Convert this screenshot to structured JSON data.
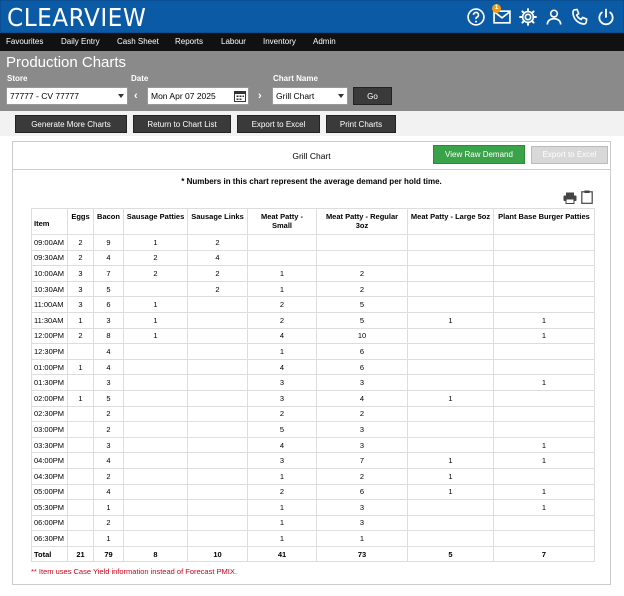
{
  "header": {
    "logo": "CLEARVIEW",
    "mail_badge": "1",
    "icons": [
      "help-icon",
      "mail-icon",
      "gear-icon",
      "user-icon",
      "phone-icon",
      "power-icon"
    ]
  },
  "nav": [
    "Favourites",
    "Daily Entry",
    "Cash Sheet",
    "Reports",
    "Labour",
    "Inventory",
    "Admin"
  ],
  "page": {
    "title": "Production Charts",
    "store_label": "Store",
    "store_value": "77777 - CV 77777",
    "date_label": "Date",
    "date_value": "Mon Apr 07 2025",
    "chart_label": "Chart Name",
    "chart_value": "Grill Chart",
    "go": "Go"
  },
  "actions": [
    "Generate More Charts",
    "Return to Chart List",
    "Export to Excel",
    "Print Charts"
  ],
  "panel": {
    "title": "Grill Chart",
    "view_raw": "View Raw Demand",
    "export": "Export to Excel",
    "note": "* Numbers in this chart represent the average demand per hold time.",
    "footnote": "** Item uses Case Yield information instead of Forecast PMIX."
  },
  "table": {
    "headers": [
      "Item",
      "Eggs",
      "Bacon",
      "Sausage Patties",
      "Sausage Links",
      "Meat Patty - Small",
      "Meat Patty - Regular 3oz",
      "Meat Patty - Large 5oz",
      "Plant Base Burger Patties"
    ],
    "rows": [
      [
        "09:00AM",
        "2",
        "9",
        "1",
        "2",
        "",
        "",
        "",
        ""
      ],
      [
        "09:30AM",
        "2",
        "4",
        "2",
        "4",
        "",
        "",
        "",
        ""
      ],
      [
        "10:00AM",
        "3",
        "7",
        "2",
        "2",
        "1",
        "2",
        "",
        ""
      ],
      [
        "10:30AM",
        "3",
        "5",
        "",
        "2",
        "1",
        "2",
        "",
        ""
      ],
      [
        "11:00AM",
        "3",
        "6",
        "1",
        "",
        "2",
        "5",
        "",
        ""
      ],
      [
        "11:30AM",
        "1",
        "3",
        "1",
        "",
        "2",
        "5",
        "1",
        "1"
      ],
      [
        "12:00PM",
        "2",
        "8",
        "1",
        "",
        "4",
        "10",
        "",
        "1"
      ],
      [
        "12:30PM",
        "",
        "4",
        "",
        "",
        "1",
        "6",
        "",
        ""
      ],
      [
        "01:00PM",
        "1",
        "4",
        "",
        "",
        "4",
        "6",
        "",
        ""
      ],
      [
        "01:30PM",
        "",
        "3",
        "",
        "",
        "3",
        "3",
        "",
        "1"
      ],
      [
        "02:00PM",
        "1",
        "5",
        "",
        "",
        "3",
        "4",
        "1",
        ""
      ],
      [
        "02:30PM",
        "",
        "2",
        "",
        "",
        "2",
        "2",
        "",
        ""
      ],
      [
        "03:00PM",
        "",
        "2",
        "",
        "",
        "5",
        "3",
        "",
        ""
      ],
      [
        "03:30PM",
        "",
        "3",
        "",
        "",
        "4",
        "3",
        "",
        "1"
      ],
      [
        "04:00PM",
        "",
        "4",
        "",
        "",
        "3",
        "7",
        "1",
        "1"
      ],
      [
        "04:30PM",
        "",
        "2",
        "",
        "",
        "1",
        "2",
        "1",
        ""
      ],
      [
        "05:00PM",
        "",
        "4",
        "",
        "",
        "2",
        "6",
        "1",
        "1"
      ],
      [
        "05:30PM",
        "",
        "1",
        "",
        "",
        "1",
        "3",
        "",
        "1"
      ],
      [
        "06:00PM",
        "",
        "2",
        "",
        "",
        "1",
        "3",
        "",
        ""
      ],
      [
        "06:30PM",
        "",
        "1",
        "",
        "",
        "1",
        "1",
        "",
        ""
      ]
    ],
    "total": [
      "Total",
      "21",
      "79",
      "8",
      "10",
      "41",
      "73",
      "5",
      "7"
    ]
  }
}
